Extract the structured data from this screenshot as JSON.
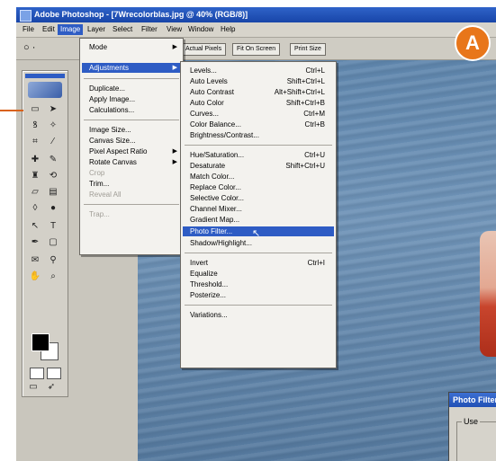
{
  "window": {
    "title": "Adobe Photoshop - [7Wrecolorblas.jpg @ 40% (RGB/8)]"
  },
  "callout": {
    "label": "A"
  },
  "menubar": [
    "File",
    "Edit",
    "Image",
    "Layer",
    "Select",
    "Filter",
    "View",
    "Window",
    "Help"
  ],
  "optbar": {
    "glyph": "○ ·",
    "buttons": [
      "Actual Pixels",
      "Fit On Screen",
      "Print Size"
    ]
  },
  "image_menu": {
    "items": [
      {
        "label": "Mode",
        "submenu": true
      },
      {
        "label": "Adjustments",
        "submenu": true,
        "highlighted": true
      },
      {
        "separator": true
      },
      {
        "label": "Duplicate..."
      },
      {
        "label": "Apply Image..."
      },
      {
        "label": "Calculations..."
      },
      {
        "separator": true
      },
      {
        "label": "Image Size..."
      },
      {
        "label": "Canvas Size..."
      },
      {
        "label": "Pixel Aspect Ratio",
        "submenu": true
      },
      {
        "label": "Rotate Canvas",
        "submenu": true
      },
      {
        "label": "Crop",
        "disabled": true
      },
      {
        "label": "Trim..."
      },
      {
        "label": "Reveal All",
        "disabled": true
      },
      {
        "separator": true
      },
      {
        "label": "Trap...",
        "disabled": true
      }
    ]
  },
  "adjustments_menu": {
    "items": [
      {
        "label": "Levels...",
        "shortcut": "Ctrl+L"
      },
      {
        "label": "Auto Levels",
        "shortcut": "Shift+Ctrl+L"
      },
      {
        "label": "Auto Contrast",
        "shortcut": "Alt+Shift+Ctrl+L"
      },
      {
        "label": "Auto Color",
        "shortcut": "Shift+Ctrl+B"
      },
      {
        "label": "Curves...",
        "shortcut": "Ctrl+M"
      },
      {
        "label": "Color Balance...",
        "shortcut": "Ctrl+B"
      },
      {
        "label": "Brightness/Contrast..."
      },
      {
        "separator": true
      },
      {
        "label": "Hue/Saturation...",
        "shortcut": "Ctrl+U"
      },
      {
        "label": "Desaturate",
        "shortcut": "Shift+Ctrl+U"
      },
      {
        "label": "Match Color..."
      },
      {
        "label": "Replace Color..."
      },
      {
        "label": "Selective Color..."
      },
      {
        "label": "Channel Mixer..."
      },
      {
        "label": "Gradient Map..."
      },
      {
        "label": "Photo Filter...",
        "highlighted": true
      },
      {
        "label": "Shadow/Highlight..."
      },
      {
        "separator": true
      },
      {
        "label": "Invert",
        "shortcut": "Ctrl+I"
      },
      {
        "label": "Equalize"
      },
      {
        "label": "Threshold..."
      },
      {
        "label": "Posterize..."
      },
      {
        "separator": true
      },
      {
        "label": "Variations..."
      }
    ]
  },
  "dialog": {
    "title": "Photo Filter",
    "group_label": "Use"
  },
  "colors": {
    "menu_highlight": "#2e5cc4",
    "callout": "#e8761a",
    "title_bar": "#1f4fb3"
  }
}
